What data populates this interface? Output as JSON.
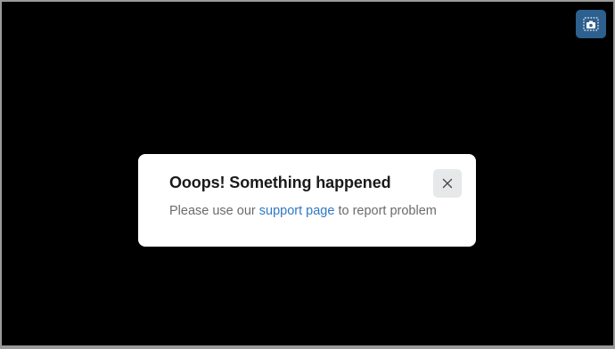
{
  "toolbar": {
    "screenshot_icon": "camera-screenshot-icon",
    "accent_color": "#2d5f8f"
  },
  "dialog": {
    "title": "Ooops! Something happened",
    "message_before": "Please use our ",
    "link_text": "support page",
    "message_after": " to report problem",
    "close_icon": "close-icon",
    "link_color": "#2f78c4"
  }
}
